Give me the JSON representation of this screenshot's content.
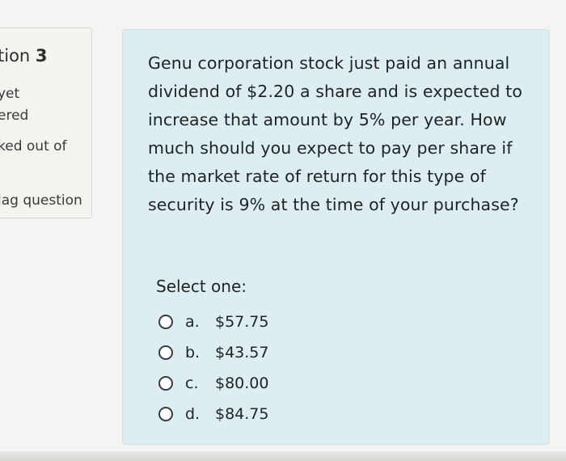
{
  "info_panel": {
    "question_label": "tion",
    "question_number": "3",
    "state_line_1": "yet",
    "state_line_2": "ered",
    "mark_text": "ked out of",
    "flag_label": "lag question"
  },
  "question": {
    "text": "Genu corporation stock just paid an annual dividend of $2.20 a share and is expected to increase that amount by 5% per year. How much should you expect to pay per share if the market rate of return for this type of security is 9% at the time of your purchase?",
    "prompt": "Select one:",
    "options": [
      {
        "letter": "a.",
        "value": "$57.75"
      },
      {
        "letter": "b.",
        "value": "$43.57"
      },
      {
        "letter": "c.",
        "value": "$80.00"
      },
      {
        "letter": "d.",
        "value": "$84.75"
      }
    ]
  }
}
